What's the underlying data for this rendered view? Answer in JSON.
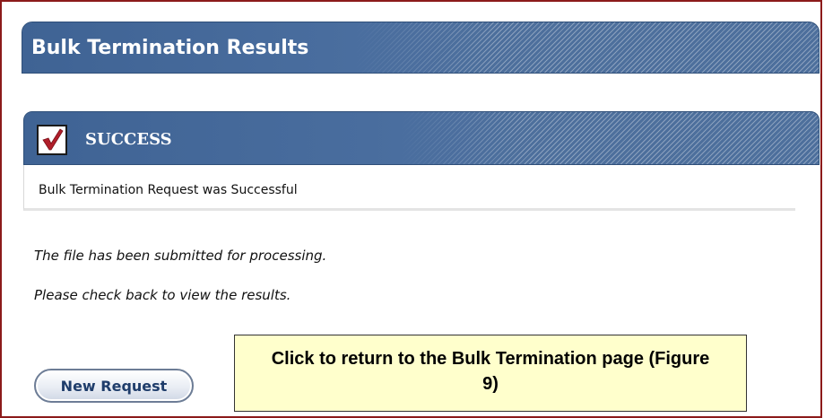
{
  "page": {
    "title": "Bulk Termination Results"
  },
  "status": {
    "label": "SUCCESS",
    "icon": "checkmark-icon",
    "message": "Bulk Termination Request was Successful"
  },
  "info": {
    "line1": "The file has been submitted for processing.",
    "line2": "Please check back to view the results."
  },
  "actions": {
    "new_request_label": "New Request"
  },
  "callout": {
    "text": "Click to return to the Bulk Termination page (Figure 9)"
  },
  "colors": {
    "header_blue": "#4d6f9c",
    "frame_border": "#8c1a1a",
    "check_red": "#b01e2a",
    "callout_bg": "#ffffcc",
    "button_text": "#1f3d6b"
  }
}
